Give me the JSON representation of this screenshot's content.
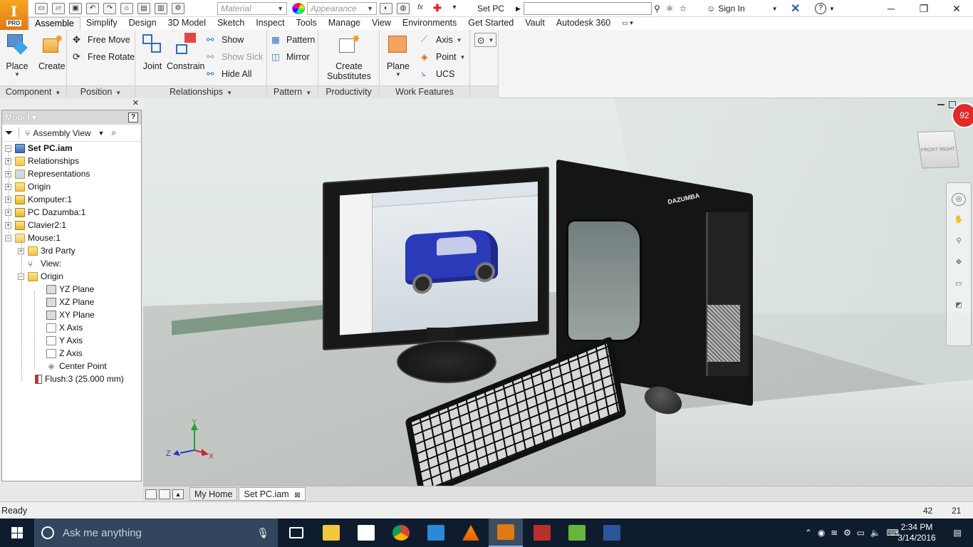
{
  "app": {
    "logo_letter": "I",
    "logo_badge": "PRO",
    "document_title": "Set PC",
    "sign_in": "Sign In",
    "material_placeholder": "Material",
    "appearance_placeholder": "Appearance",
    "fx_label": "fx"
  },
  "ribbon_tabs": [
    "Assemble",
    "Simplify",
    "Design",
    "3D Model",
    "Sketch",
    "Inspect",
    "Tools",
    "Manage",
    "View",
    "Environments",
    "Get Started",
    "Vault",
    "Autodesk 360"
  ],
  "ribbon": {
    "component": {
      "title": "Component",
      "place": "Place",
      "create": "Create"
    },
    "position": {
      "title": "Position",
      "free_move": "Free Move",
      "free_rotate": "Free Rotate"
    },
    "relationships": {
      "title": "Relationships",
      "joint": "Joint",
      "constrain": "Constrain",
      "show": "Show",
      "show_sick": "Show Sick",
      "hide_all": "Hide All"
    },
    "pattern": {
      "title": "Pattern",
      "pattern": "Pattern",
      "mirror": "Mirror"
    },
    "productivity": {
      "title": "Productivity",
      "create_substitutes_1": "Create",
      "create_substitutes_2": "Substitutes"
    },
    "work_features": {
      "title": "Work Features",
      "plane": "Plane",
      "axis": "Axis",
      "point": "Point",
      "ucs": "UCS"
    }
  },
  "browser": {
    "title": "Model",
    "help": "?",
    "view_mode": "Assembly View",
    "root": "Set PC.iam",
    "items": [
      {
        "label": "Relationships"
      },
      {
        "label": "Representations"
      },
      {
        "label": "Origin"
      },
      {
        "label": "Komputer:1"
      },
      {
        "label": "PC Dazumba:1"
      },
      {
        "label": "Clavier2:1"
      },
      {
        "label": "Mouse:1"
      },
      {
        "label": "3rd Party"
      },
      {
        "label": "View:"
      },
      {
        "label": "Origin"
      },
      {
        "label": "YZ Plane"
      },
      {
        "label": "XZ Plane"
      },
      {
        "label": "XY Plane"
      },
      {
        "label": "X Axis"
      },
      {
        "label": "Y Axis"
      },
      {
        "label": "Z Axis"
      },
      {
        "label": "Center Point"
      },
      {
        "label": "Flush:3 (25.000 mm)"
      }
    ]
  },
  "viewport": {
    "badge_count": "92",
    "viewcube_front": "FRONT",
    "viewcube_right": "RIGHT",
    "tower_logo": "DAZUMBA",
    "triad_x": "X",
    "triad_y": "Y",
    "triad_z": "Z"
  },
  "doc_tabs": [
    "My Home",
    "Set PC.iam"
  ],
  "status": {
    "text": "Ready",
    "num1": "42",
    "num2": "21"
  },
  "taskbar": {
    "search_placeholder": "Ask me anything",
    "time": "2:34 PM",
    "date": "3/14/2016"
  },
  "colors": {
    "accent_orange": "#e07a12",
    "taskbar_bg": "#0f1c2e",
    "badge_red": "#e02b2b"
  }
}
